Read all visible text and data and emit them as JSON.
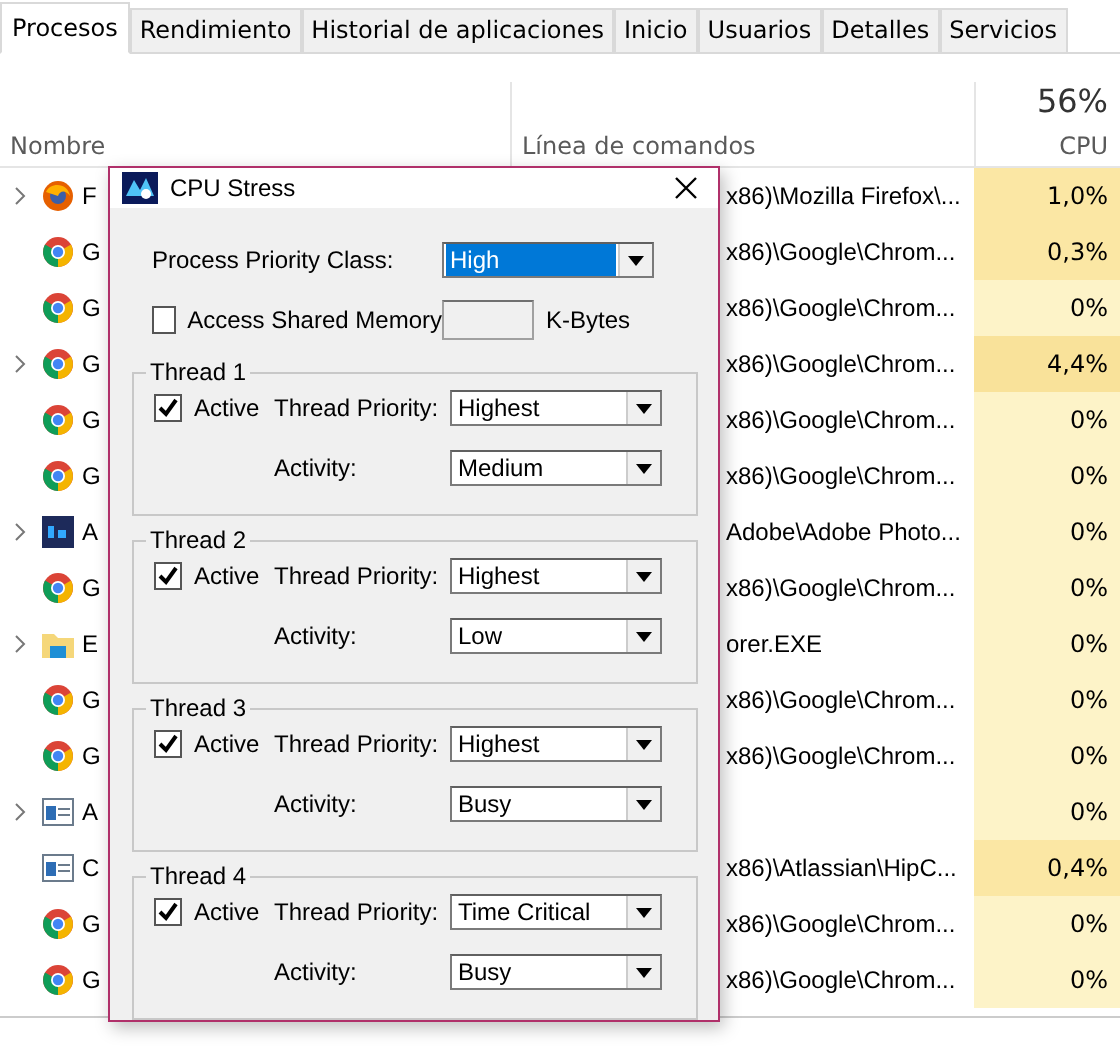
{
  "tabs": [
    {
      "label": "Procesos",
      "selected": true
    },
    {
      "label": "Rendimiento",
      "selected": false
    },
    {
      "label": "Historial de aplicaciones",
      "selected": false
    },
    {
      "label": "Inicio",
      "selected": false
    },
    {
      "label": "Usuarios",
      "selected": false
    },
    {
      "label": "Detalles",
      "selected": false
    },
    {
      "label": "Servicios",
      "selected": false
    }
  ],
  "columns": {
    "name": "Nombre",
    "command": "Línea de comandos",
    "cpu_total": "56%",
    "cpu": "CPU"
  },
  "rows": [
    {
      "kind": "firefox",
      "name": "F",
      "command": "x86)\\Mozilla Firefox\\...",
      "cpu": "1,0%",
      "color": "#fbe7a4",
      "expandable": true
    },
    {
      "kind": "chrome",
      "name": "G",
      "command": "x86)\\Google\\Chrom...",
      "cpu": "0,3%",
      "color": "#fbe7a4",
      "expandable": false
    },
    {
      "kind": "chrome",
      "name": "G",
      "command": "x86)\\Google\\Chrom...",
      "cpu": "0%",
      "color": "#fdf3c8",
      "expandable": false
    },
    {
      "kind": "chrome",
      "name": "G",
      "command": "x86)\\Google\\Chrom...",
      "cpu": "4,4%",
      "color": "#f9e29a",
      "expandable": true
    },
    {
      "kind": "chrome",
      "name": "G",
      "command": "x86)\\Google\\Chrom...",
      "cpu": "0%",
      "color": "#fdf3c8",
      "expandable": false
    },
    {
      "kind": "chrome",
      "name": "G",
      "command": "x86)\\Google\\Chrom...",
      "cpu": "0%",
      "color": "#fdf3c8",
      "expandable": false
    },
    {
      "kind": "photoshop",
      "name": "A",
      "command": "Adobe\\Adobe Photo...",
      "cpu": "0%",
      "color": "#fdf3c8",
      "expandable": true
    },
    {
      "kind": "chrome",
      "name": "G",
      "command": "x86)\\Google\\Chrom...",
      "cpu": "0%",
      "color": "#fdf3c8",
      "expandable": false
    },
    {
      "kind": "folder",
      "name": "E",
      "command": "orer.EXE",
      "cpu": "0%",
      "color": "#fdf3c8",
      "expandable": true
    },
    {
      "kind": "chrome",
      "name": "G",
      "command": "x86)\\Google\\Chrom...",
      "cpu": "0%",
      "color": "#fdf3c8",
      "expandable": false
    },
    {
      "kind": "chrome",
      "name": "G",
      "command": "x86)\\Google\\Chrom...",
      "cpu": "0%",
      "color": "#fdf3c8",
      "expandable": false
    },
    {
      "kind": "app",
      "name": "A",
      "command": "",
      "cpu": "0%",
      "color": "#fdf3c8",
      "expandable": true
    },
    {
      "kind": "app",
      "name": "C",
      "command": "x86)\\Atlassian\\HipC...",
      "cpu": "0,4%",
      "color": "#fbe7a4",
      "expandable": false
    },
    {
      "kind": "chrome",
      "name": "G",
      "command": "x86)\\Google\\Chrom...",
      "cpu": "0%",
      "color": "#fdf3c8",
      "expandable": false
    },
    {
      "kind": "chrome",
      "name": "G",
      "command": "x86)\\Google\\Chrom...",
      "cpu": "0%",
      "color": "#fdf3c8",
      "expandable": false
    }
  ],
  "dialog": {
    "title": "CPU Stress",
    "priority_label": "Process Priority Class:",
    "priority_value": "High",
    "shared_memory": {
      "label": "Access Shared Memory",
      "checked": false,
      "unit": "K-Bytes"
    },
    "threads": [
      {
        "title": "Thread 1",
        "active_label": "Active",
        "active": true,
        "priority_label": "Thread Priority:",
        "priority": "Highest",
        "activity_label": "Activity:",
        "activity": "Medium"
      },
      {
        "title": "Thread 2",
        "active_label": "Active",
        "active": true,
        "priority_label": "Thread Priority:",
        "priority": "Highest",
        "activity_label": "Activity:",
        "activity": "Low"
      },
      {
        "title": "Thread 3",
        "active_label": "Active",
        "active": true,
        "priority_label": "Thread Priority:",
        "priority": "Highest",
        "activity_label": "Activity:",
        "activity": "Busy"
      },
      {
        "title": "Thread 4",
        "active_label": "Active",
        "active": true,
        "priority_label": "Thread Priority:",
        "priority": "Time Critical",
        "activity_label": "Activity:",
        "activity": "Busy"
      }
    ]
  }
}
